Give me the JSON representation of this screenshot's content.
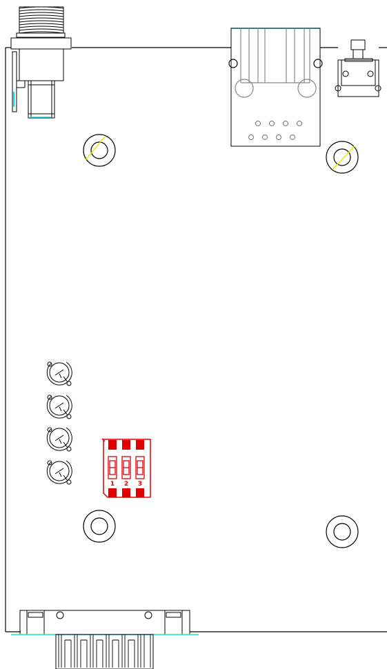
{
  "diagram": {
    "colors": {
      "outline": "#000000",
      "component_gray": "#888888",
      "highlight_cyan": "#00e5ee",
      "highlight_yellow": "#e8e800",
      "dip_red": "#e00000",
      "dip_fill": "#e00000"
    },
    "dip_switch": {
      "labels": [
        "1",
        "2",
        "3"
      ]
    }
  }
}
